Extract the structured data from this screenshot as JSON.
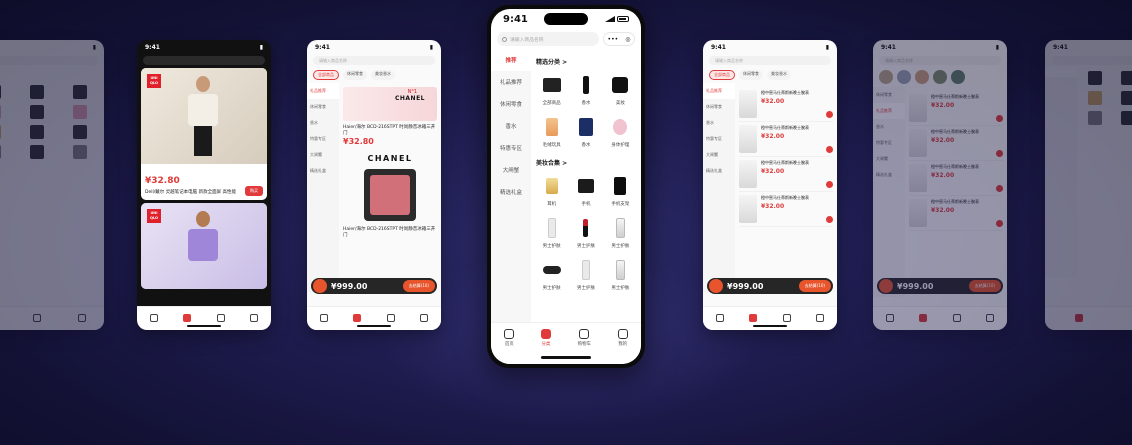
{
  "status_time": "9:41",
  "hero": {
    "search_placeholder": "请输入商品名称",
    "capsule_more": "•••",
    "capsule_close": "◎",
    "sidebar": [
      "推荐",
      "礼品推荐",
      "休闲零食",
      "香水",
      "特惠专区",
      "大闸蟹",
      "精选礼盒"
    ],
    "section1_title": "精选分类 >",
    "section1_items": [
      {
        "label": "全部商品",
        "icon": "p-box"
      },
      {
        "label": "香水",
        "icon": "p-tube"
      },
      {
        "label": "美妆",
        "icon": "p-jar"
      },
      {
        "label": "毛绒玩具",
        "icon": "p-perfume"
      },
      {
        "label": "香水",
        "icon": "p-blue"
      },
      {
        "label": "身体护理",
        "icon": "p-pink"
      }
    ],
    "section2_title": "美妆合集 >",
    "section2_items": [
      {
        "label": "耳机",
        "icon": "p-gold"
      },
      {
        "label": "手机",
        "icon": "p-dark"
      },
      {
        "label": "手机支架",
        "icon": "p-black"
      },
      {
        "label": "男士护肤",
        "icon": "p-white"
      },
      {
        "label": "男士护肤",
        "icon": "p-lip"
      },
      {
        "label": "男士护肤",
        "icon": "p-bottle"
      },
      {
        "label": "男士护肤",
        "icon": "p-compact"
      },
      {
        "label": "男士护肤",
        "icon": "p-white"
      },
      {
        "label": "男士护肤",
        "icon": "p-bottle"
      }
    ],
    "tabs": [
      "首页",
      "分类",
      "购物车",
      "我的"
    ]
  },
  "fashion": {
    "logo_text": "UNI QLO",
    "price": "¥32.80",
    "price_note": "¥32.80",
    "title": "Dell/戴尔 灵越笔记本电脑 新款全面屏 高性能",
    "btn": "购买"
  },
  "chanel": {
    "banner_no": "N°1",
    "banner_logo": "CHANEL",
    "item_title": "Haier/海尔 BCD-216STPT 时尚静音冰箱三开门",
    "price": "¥32.80",
    "big_logo": "CHANEL",
    "item_title2": "Haier/海尔 BCD-216STPT 时尚静音冰箱三开门"
  },
  "list_screen": {
    "item_title": "橙中窖马仕蒂斯新晚士腕表",
    "price": "¥32.00"
  },
  "cart": {
    "price": "¥999.00",
    "button": "去结算(10)"
  },
  "mini_tabs": [
    "全部商品",
    "休闲零食",
    "美妆香水"
  ],
  "mini_sidebar": [
    "礼品推荐",
    "休闲零食",
    "香水",
    "特惠专区",
    "大闸蟹",
    "精选礼盒"
  ]
}
